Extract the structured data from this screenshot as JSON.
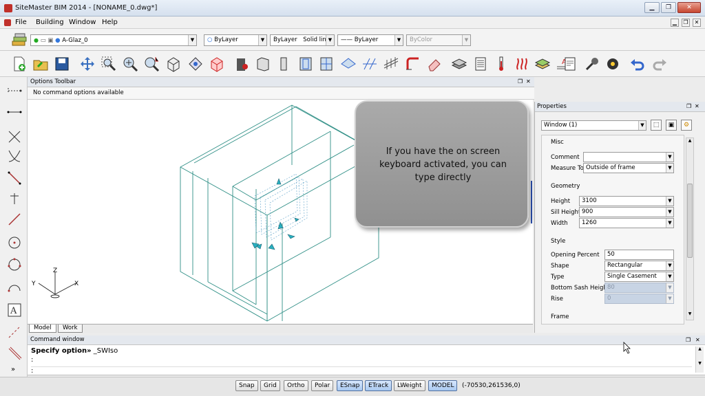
{
  "app": {
    "title": "SiteMaster BIM 2014 - [NONAME_0.dwg*]"
  },
  "window_controls": {
    "minimize": "▁",
    "restore": "❐",
    "close": "✕"
  },
  "menu": {
    "items": [
      "File",
      "Building",
      "Window",
      "Help"
    ]
  },
  "layerbar": {
    "layer": "A-Glaz_0",
    "color": "ByLayer",
    "linetype": "ByLayer",
    "linetype_style": "Solid line",
    "lineweight": "ByLayer",
    "plotstyle": "ByColor"
  },
  "options_toolbar": {
    "title": "Options Toolbar",
    "message": "No command options available"
  },
  "viewport": {
    "tabs": [
      "Model",
      "Work"
    ],
    "ucs": {
      "x": "X",
      "y": "Y",
      "z": "Z"
    },
    "tooltip": {
      "line1": "If you have the on screen",
      "line2": "keyboard activated, you can",
      "line3": "type directly"
    }
  },
  "properties": {
    "title": "Properties",
    "selector": "Window (1)",
    "sections": {
      "misc": "Misc",
      "geometry": "Geometry",
      "style": "Style",
      "frame": "Frame"
    },
    "fields": {
      "comment": {
        "label": "Comment",
        "value": ""
      },
      "measure_to": {
        "label": "Measure To",
        "value": "Outside of frame"
      },
      "height": {
        "label": "Height",
        "value": "3100"
      },
      "sill_height": {
        "label": "Sill Height",
        "value": "900"
      },
      "width": {
        "label": "Width",
        "value": "1260"
      },
      "opening_percent": {
        "label": "Opening Percent",
        "value": "50"
      },
      "shape": {
        "label": "Shape",
        "value": "Rectangular"
      },
      "type": {
        "label": "Type",
        "value": "Single Casement"
      },
      "bottom_sash_height": {
        "label": "Bottom Sash Height",
        "value": "80"
      },
      "rise": {
        "label": "Rise",
        "value": "0"
      }
    }
  },
  "command": {
    "title": "Command window",
    "prompt": "Specify option»",
    "input": "_SWIso",
    "line2": ":",
    "line3": ":"
  },
  "status": {
    "buttons": [
      "Snap",
      "Grid",
      "Ortho",
      "Polar",
      "ESnap",
      "ETrack",
      "LWeight",
      "MODEL"
    ],
    "active": [
      "ESnap",
      "ETrack",
      "MODEL"
    ],
    "coords": "(-70530,261536,0)"
  },
  "colors": {
    "model_lines": "#2f8f86",
    "grips": "#2ab0c0",
    "titlebar": "#d5e0ee"
  }
}
